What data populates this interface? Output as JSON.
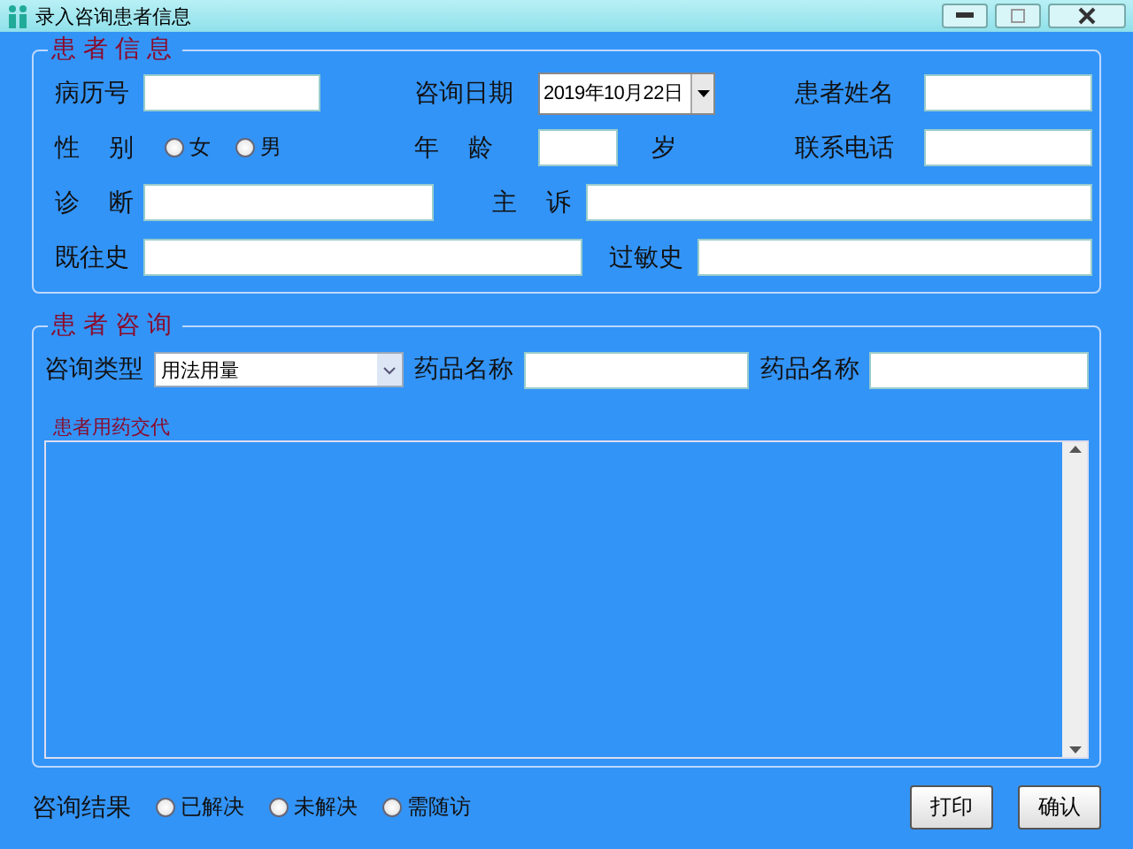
{
  "window": {
    "title": "录入咨询患者信息"
  },
  "patient_info": {
    "legend": "患者信息",
    "rows": [
      [
        {
          "kind": "label",
          "text": "病历号"
        },
        {
          "kind": "input"
        },
        {
          "kind": "label",
          "text": "咨询日期"
        },
        {
          "kind": "date",
          "value": "2019年10月22日"
        },
        {
          "kind": "label",
          "text": "患者姓名"
        },
        {
          "kind": "input"
        }
      ],
      [
        {
          "kind": "label",
          "text": "性 别"
        },
        {
          "kind": "radios",
          "options": [
            {
              "label": "女",
              "selected": false
            },
            {
              "label": "男",
              "selected": false
            }
          ]
        },
        {
          "kind": "label",
          "text": "年 龄"
        },
        {
          "kind": "input",
          "unit": "岁"
        },
        {
          "kind": "label",
          "text": "联系电话"
        },
        {
          "kind": "input"
        }
      ]
    ],
    "diagnosis": {
      "label": "诊 断"
    },
    "complaint": {
      "label": "主 诉"
    },
    "history": {
      "label": "既往史"
    },
    "allergy": {
      "label": "过敏史"
    }
  },
  "consultation": {
    "legend": "患者咨询",
    "type_label": "咨询类型",
    "type_value": "用法用量",
    "drug_labels": [
      "药品名称",
      "药品名称"
    ],
    "notes_legend": "患者用药交代"
  },
  "result": {
    "label": "咨询结果",
    "options": [
      {
        "label": "已解决",
        "selected": false
      },
      {
        "label": "未解决",
        "selected": false
      },
      {
        "label": "需随访",
        "selected": false
      }
    ]
  },
  "buttons": [
    "打印",
    "确认"
  ]
}
